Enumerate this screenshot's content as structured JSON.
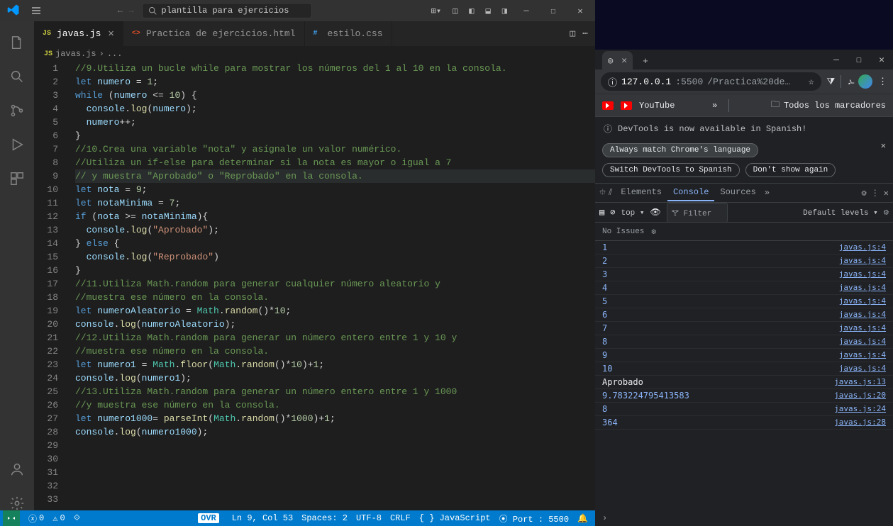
{
  "vscode": {
    "search_value": "plantilla para ejercicios",
    "tabs": [
      {
        "label": "javas.js",
        "icon": "JS",
        "active": true,
        "dirty": false
      },
      {
        "label": "Practica de ejercicios.html",
        "icon": "<>",
        "active": false
      },
      {
        "label": "estilo.css",
        "icon": "#",
        "active": false
      }
    ],
    "breadcrumb": {
      "icon": "JS",
      "file": "javas.js",
      "sep": "›",
      "more": "..."
    },
    "code_lines": [
      {
        "n": 1,
        "html": "<span class='tok-com'>//9.Utiliza un bucle while para mostrar los números del 1 al 10 en la consola.</span>"
      },
      {
        "n": 2,
        "html": "<span class='tok-kw'>let</span> <span class='tok-var'>numero</span> = <span class='tok-num'>1</span>;"
      },
      {
        "n": 3,
        "html": "<span class='tok-kw'>while</span> (<span class='tok-var'>numero</span> &lt;= <span class='tok-num'>10</span>) {"
      },
      {
        "n": 4,
        "html": "  <span class='tok-var'>console</span>.<span class='tok-fn'>log</span>(<span class='tok-var'>numero</span>);"
      },
      {
        "n": 5,
        "html": "  <span class='tok-var'>numero</span>++;"
      },
      {
        "n": 6,
        "html": "}"
      },
      {
        "n": 7,
        "html": "<span class='tok-com'>//10.Crea una variable &quot;nota&quot; y asígnale un valor numérico.</span>"
      },
      {
        "n": 8,
        "html": "<span class='tok-com'>//Utiliza un if-else para determinar si la nota es mayor o igual a 7</span>"
      },
      {
        "n": 9,
        "html": "<span class='tok-com'>// y muestra &quot;Aprobado&quot; o &quot;Reprobado&quot; en la consola.</span>",
        "hl": true
      },
      {
        "n": 10,
        "html": "<span class='tok-kw'>let</span> <span class='tok-var'>nota</span> = <span class='tok-num'>9</span>;"
      },
      {
        "n": 11,
        "html": "<span class='tok-kw'>let</span> <span class='tok-var'>notaMinima</span> = <span class='tok-num'>7</span>;"
      },
      {
        "n": 12,
        "html": "<span class='tok-kw'>if</span> (<span class='tok-var'>nota</span> &gt;= <span class='tok-var'>notaMinima</span>){"
      },
      {
        "n": 13,
        "html": "  <span class='tok-var'>console</span>.<span class='tok-fn'>log</span>(<span class='tok-str'>&quot;Aprobado&quot;</span>);"
      },
      {
        "n": 14,
        "html": "} <span class='tok-kw'>else</span> {"
      },
      {
        "n": 15,
        "html": "  <span class='tok-var'>console</span>.<span class='tok-fn'>log</span>(<span class='tok-str'>&quot;Reprobado&quot;</span>)"
      },
      {
        "n": 16,
        "html": "}"
      },
      {
        "n": 17,
        "html": "<span class='tok-com'>//11.Utiliza Math.random para generar cualquier número aleatorio y</span>"
      },
      {
        "n": 18,
        "html": "<span class='tok-com'>//muestra ese número en la consola.</span>"
      },
      {
        "n": 19,
        "html": "<span class='tok-kw'>let</span> <span class='tok-var'>numeroAleatorio</span> = <span class='tok-obj'>Math</span>.<span class='tok-fn'>random</span>()*<span class='tok-num'>10</span>;"
      },
      {
        "n": 20,
        "html": "<span class='tok-var'>console</span>.<span class='tok-fn'>log</span>(<span class='tok-var'>numeroAleatorio</span>);"
      },
      {
        "n": 21,
        "html": "<span class='tok-com'>//12.Utiliza Math.random para generar un número entero entre 1 y 10 y</span>"
      },
      {
        "n": 22,
        "html": "<span class='tok-com'>//muestra ese número en la consola.</span>"
      },
      {
        "n": 23,
        "html": "<span class='tok-kw'>let</span> <span class='tok-var'>numero1</span> = <span class='tok-obj'>Math</span>.<span class='tok-fn'>floor</span>(<span class='tok-obj'>Math</span>.<span class='tok-fn'>random</span>()*<span class='tok-num'>10</span>)+<span class='tok-num'>1</span>;"
      },
      {
        "n": 24,
        "html": "<span class='tok-var'>console</span>.<span class='tok-fn'>log</span>(<span class='tok-var'>numero1</span>);"
      },
      {
        "n": 25,
        "html": "<span class='tok-com'>//13.Utiliza Math.random para generar un número entero entre 1 y 1000</span>"
      },
      {
        "n": 26,
        "html": "<span class='tok-com'>//y muestra ese número en la consola.</span>"
      },
      {
        "n": 27,
        "html": "<span class='tok-kw'>let</span> <span class='tok-var'>numero1000</span>= <span class='tok-fn'>parseInt</span>(<span class='tok-obj'>Math</span>.<span class='tok-fn'>random</span>()*<span class='tok-num'>1000</span>)+<span class='tok-num'>1</span>;"
      },
      {
        "n": 28,
        "html": "<span class='tok-var'>console</span>.<span class='tok-fn'>log</span>(<span class='tok-var'>numero1000</span>);"
      },
      {
        "n": 29,
        "html": ""
      },
      {
        "n": 30,
        "html": ""
      },
      {
        "n": 31,
        "html": ""
      },
      {
        "n": 32,
        "html": ""
      },
      {
        "n": 33,
        "html": ""
      }
    ],
    "status": {
      "errors": "0",
      "warnings": "0",
      "ovr": "OVR",
      "line_col": "Ln 9, Col 53",
      "spaces": "Spaces: 2",
      "encoding": "UTF-8",
      "eol": "CRLF",
      "lang": "{ } JavaScript",
      "port": "⦿ Port : 5500"
    }
  },
  "browser": {
    "tab_label": "",
    "url_host": "127.0.0.1",
    "url_port": ":5500",
    "url_path": "/Practica%20de…",
    "bookmark_youtube": "YouTube",
    "all_bookmarks": "Todos los marcadores",
    "devtools": {
      "notice": "DevTools is now available in Spanish!",
      "chips": [
        "Always match Chrome's language",
        "Switch DevTools to Spanish",
        "Don't show again"
      ],
      "tabs": [
        "Elements",
        "Console",
        "Sources"
      ],
      "filter_placeholder": "Filter",
      "top_label": "top ▾",
      "levels_label": "Default levels ▾",
      "no_issues": "No Issues",
      "logs": [
        {
          "msg": "1",
          "src": "javas.js:4",
          "type": "num"
        },
        {
          "msg": "2",
          "src": "javas.js:4",
          "type": "num"
        },
        {
          "msg": "3",
          "src": "javas.js:4",
          "type": "num"
        },
        {
          "msg": "4",
          "src": "javas.js:4",
          "type": "num"
        },
        {
          "msg": "5",
          "src": "javas.js:4",
          "type": "num"
        },
        {
          "msg": "6",
          "src": "javas.js:4",
          "type": "num"
        },
        {
          "msg": "7",
          "src": "javas.js:4",
          "type": "num"
        },
        {
          "msg": "8",
          "src": "javas.js:4",
          "type": "num"
        },
        {
          "msg": "9",
          "src": "javas.js:4",
          "type": "num"
        },
        {
          "msg": "10",
          "src": "javas.js:4",
          "type": "num"
        },
        {
          "msg": "Aprobado",
          "src": "javas.js:13",
          "type": "str"
        },
        {
          "msg": "9.783224795413583",
          "src": "javas.js:20",
          "type": "num"
        },
        {
          "msg": "8",
          "src": "javas.js:24",
          "type": "num"
        },
        {
          "msg": "364",
          "src": "javas.js:28",
          "type": "num"
        }
      ]
    }
  }
}
